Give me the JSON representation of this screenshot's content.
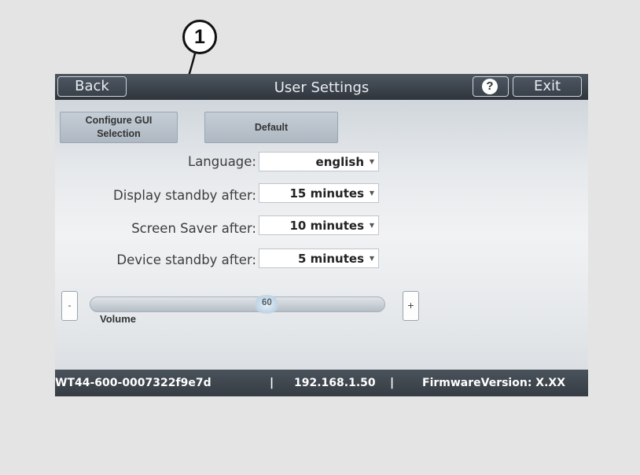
{
  "callout": {
    "number": "1"
  },
  "header": {
    "back_label": "Back",
    "title": "User Settings",
    "exit_label": "Exit",
    "help_icon": "help-icon"
  },
  "actions": {
    "configure_gui_line1": "Configure GUI",
    "configure_gui_line2": "Selection",
    "default_label": "Default"
  },
  "settings": [
    {
      "label": "Language:",
      "value": "english"
    },
    {
      "label": "Display standby after:",
      "value": "15 minutes"
    },
    {
      "label": "Screen Saver after:",
      "value": "10 minutes"
    },
    {
      "label": "Device standby after:",
      "value": "5 minutes"
    }
  ],
  "volume": {
    "label": "Volume",
    "value": "60",
    "value_fraction": 0.6,
    "decrease_label": "-",
    "increase_label": "+"
  },
  "status": {
    "device_id": "WT44-600-0007322f9e7d",
    "separator": "|",
    "ip": "192.168.1.50",
    "firmware": "FirmwareVersion: X.XX"
  }
}
